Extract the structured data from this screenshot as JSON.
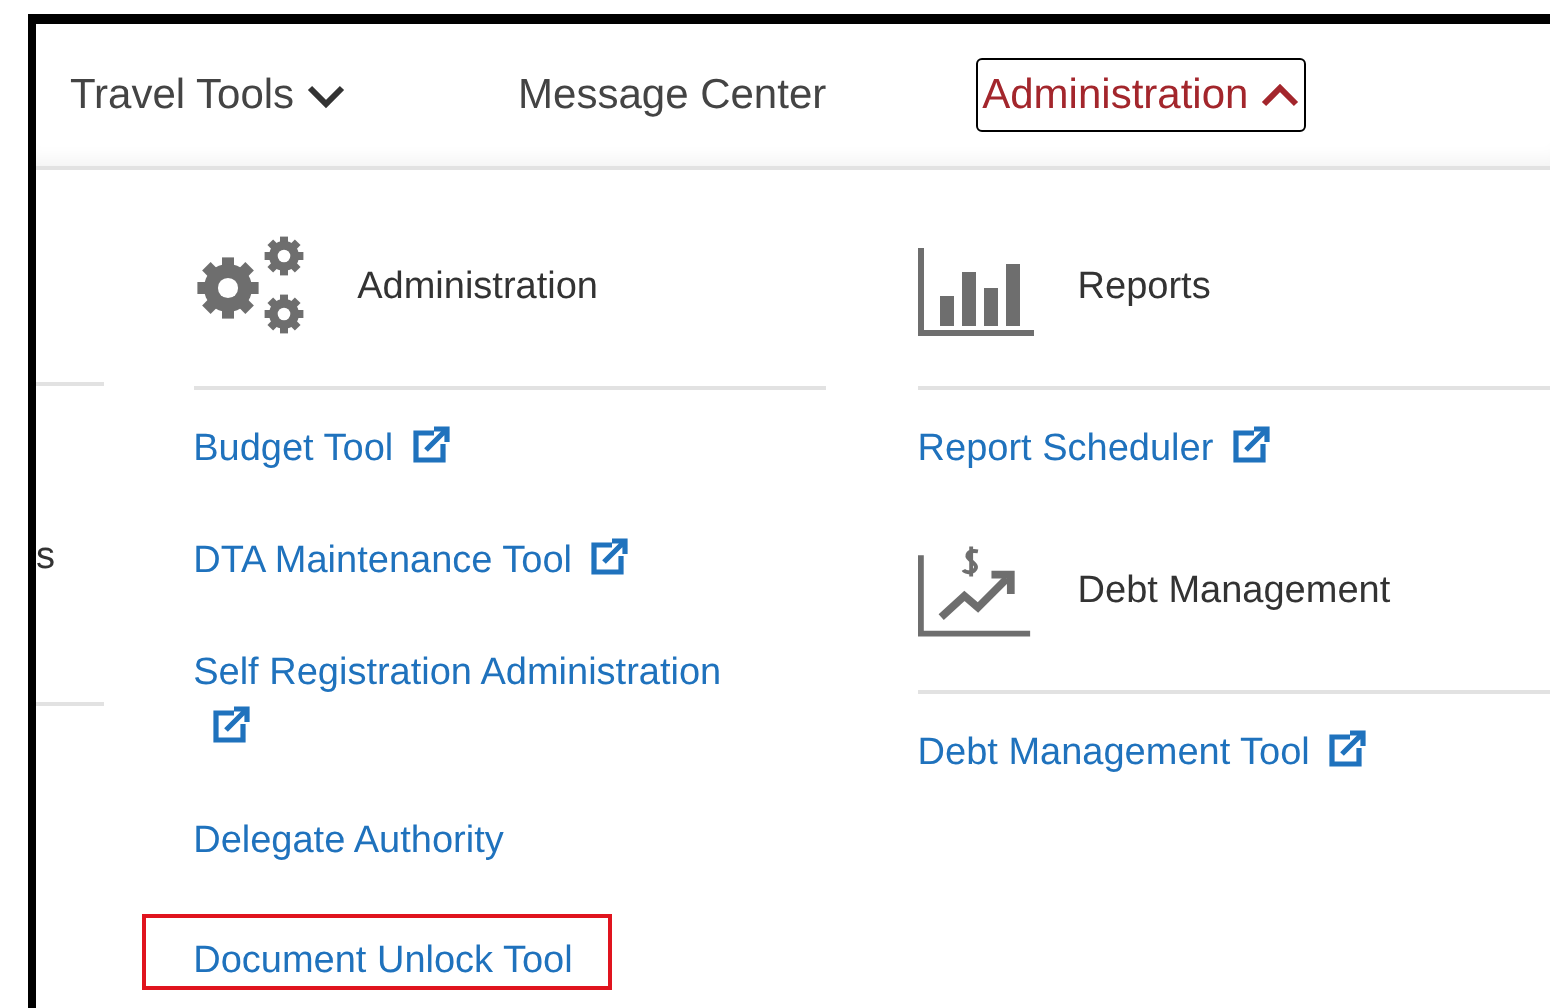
{
  "nav": [
    {
      "label": "Travel Tools",
      "kind": "dropdown",
      "expanded": false,
      "selected": false
    },
    {
      "label": "Message Center",
      "kind": "plain",
      "selected": false
    },
    {
      "label": "Administration",
      "kind": "dropdown",
      "expanded": true,
      "selected": true
    }
  ],
  "left_panel": {
    "text_fragment": "s"
  },
  "columns": [
    {
      "sections": [
        {
          "kind": "gears",
          "title": "Administration",
          "links": [
            {
              "label": "Budget Tool",
              "external": true,
              "highlighted": false
            },
            {
              "label": "DTA Maintenance Tool",
              "external": true,
              "highlighted": false
            },
            {
              "label": "Self Registration Administration",
              "external": true,
              "highlighted": false
            },
            {
              "label": "Delegate Authority",
              "external": false,
              "highlighted": false
            },
            {
              "label": "Document Unlock Tool",
              "external": false,
              "highlighted": true
            }
          ]
        }
      ]
    },
    {
      "sections": [
        {
          "kind": "chart",
          "title": "Reports",
          "links": [
            {
              "label": "Report Scheduler",
              "external": true,
              "highlighted": false
            }
          ]
        },
        {
          "kind": "money",
          "title": "Debt Management",
          "links": [
            {
              "label": "Debt Management Tool",
              "external": true,
              "highlighted": false
            }
          ]
        }
      ]
    }
  ]
}
